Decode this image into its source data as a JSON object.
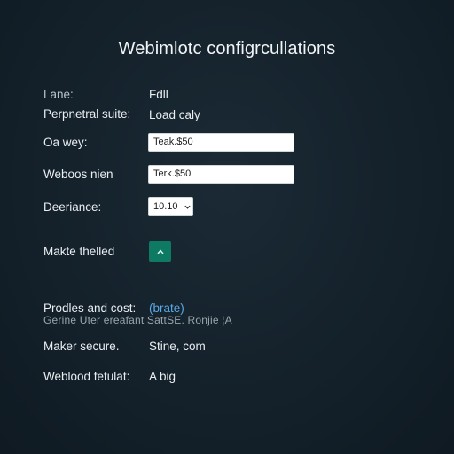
{
  "header": {
    "title": "Webimlotc configrcullations"
  },
  "rows": {
    "lane": {
      "label": "Lane:",
      "value": "Fdll"
    },
    "peripheral": {
      "label": "Perpnetral suite:",
      "value": "Load caly"
    },
    "oa_wey": {
      "label": "Oa wey:",
      "input_value": "Teak.$50"
    },
    "webooos": {
      "label": "Weboos nien",
      "input_value": "Terk.$50"
    },
    "deeriance": {
      "label": "Deeriance:",
      "select_value": "10.10"
    },
    "makte": {
      "label": "Makte thelled"
    },
    "prodles": {
      "label": "Prodles and cost:",
      "link": "(brate)"
    },
    "overlap_text": "Gerine Uter ereafant SattSE. Ronjie ¦A",
    "maker_secure": {
      "label": "Maker secure.",
      "value": "Stine, com"
    },
    "weblood": {
      "label": "Weblood fetulat:",
      "value": "A big"
    }
  },
  "icons": {
    "select_chevron": "chevron-down-icon",
    "toggle": "chevron-up-icon"
  },
  "colors": {
    "background": "#14212b",
    "accent_button": "#0e7a64",
    "link": "#5aa8e6"
  }
}
